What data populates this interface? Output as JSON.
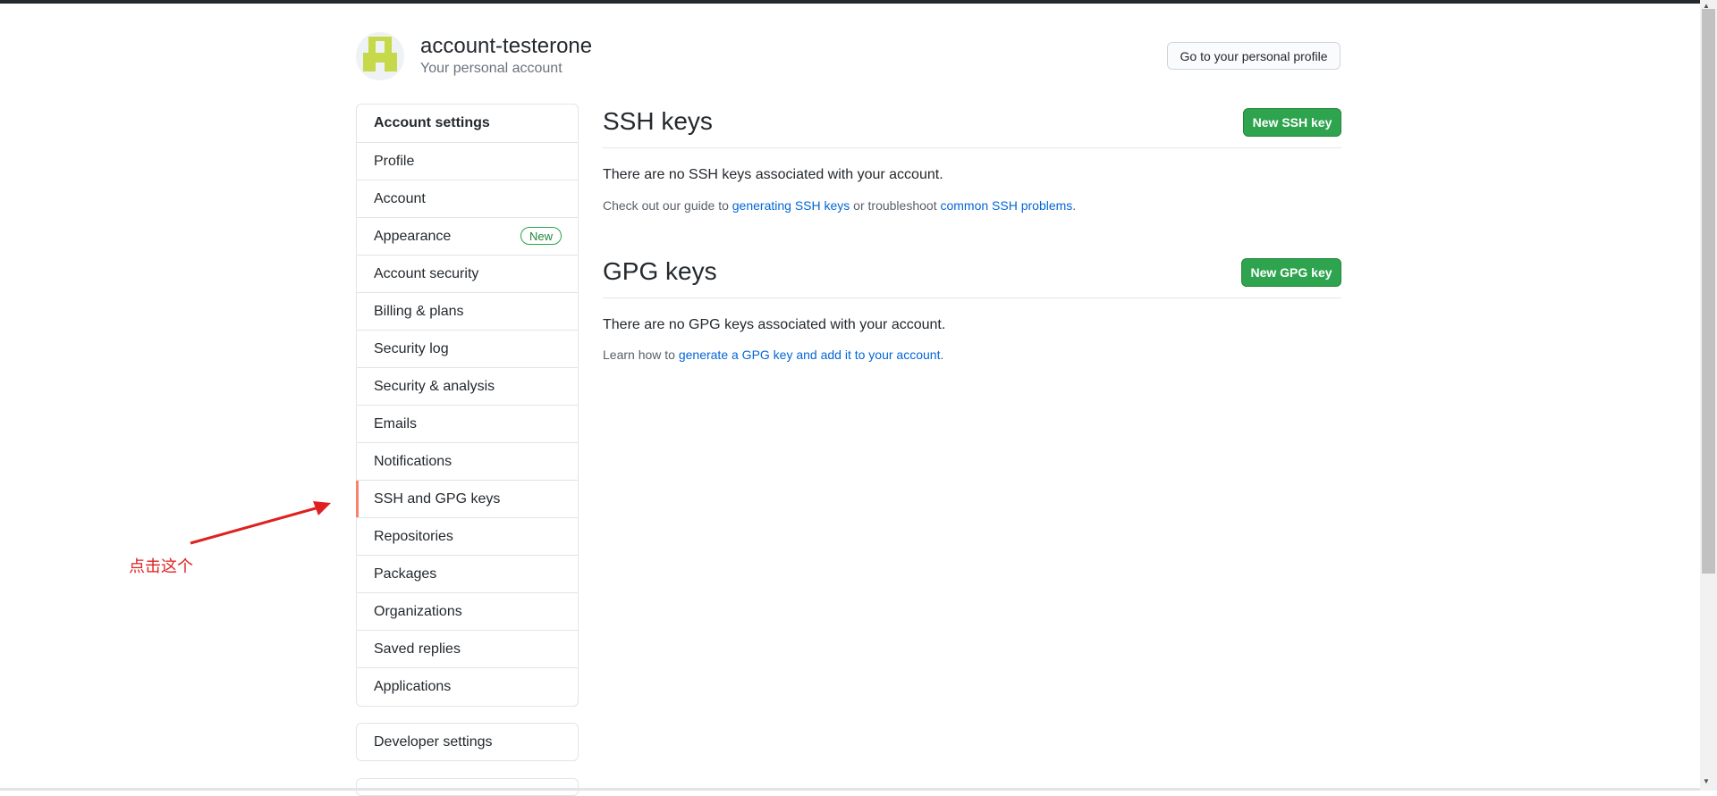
{
  "header": {
    "username": "account-testerone",
    "subtitle": "Your personal account",
    "profile_button": "Go to your personal profile"
  },
  "sidebar": {
    "heading": "Account settings",
    "items": [
      {
        "label": "Profile"
      },
      {
        "label": "Account"
      },
      {
        "label": "Appearance",
        "badge": "New"
      },
      {
        "label": "Account security"
      },
      {
        "label": "Billing & plans"
      },
      {
        "label": "Security log"
      },
      {
        "label": "Security & analysis"
      },
      {
        "label": "Emails"
      },
      {
        "label": "Notifications"
      },
      {
        "label": "SSH and GPG keys",
        "selected": true
      },
      {
        "label": "Repositories"
      },
      {
        "label": "Packages"
      },
      {
        "label": "Organizations"
      },
      {
        "label": "Saved replies"
      },
      {
        "label": "Applications"
      }
    ],
    "developer_settings": "Developer settings"
  },
  "ssh": {
    "title": "SSH keys",
    "button": "New SSH key",
    "empty": "There are no SSH keys associated with your account.",
    "note_prefix": "Check out our guide to ",
    "note_link1": "generating SSH keys",
    "note_middle": " or troubleshoot ",
    "note_link2": "common SSH problems",
    "note_suffix": "."
  },
  "gpg": {
    "title": "GPG keys",
    "button": "New GPG key",
    "empty": "There are no GPG keys associated with your account.",
    "note_prefix": "Learn how to ",
    "note_link": "generate a GPG key and add it to your account",
    "note_suffix": "."
  },
  "annotation": {
    "text": "点击这个"
  },
  "colors": {
    "accent_green": "#2ea44f",
    "link_blue": "#0366d6",
    "selected_marker": "#f9826c",
    "annotation_red": "#e02020"
  }
}
